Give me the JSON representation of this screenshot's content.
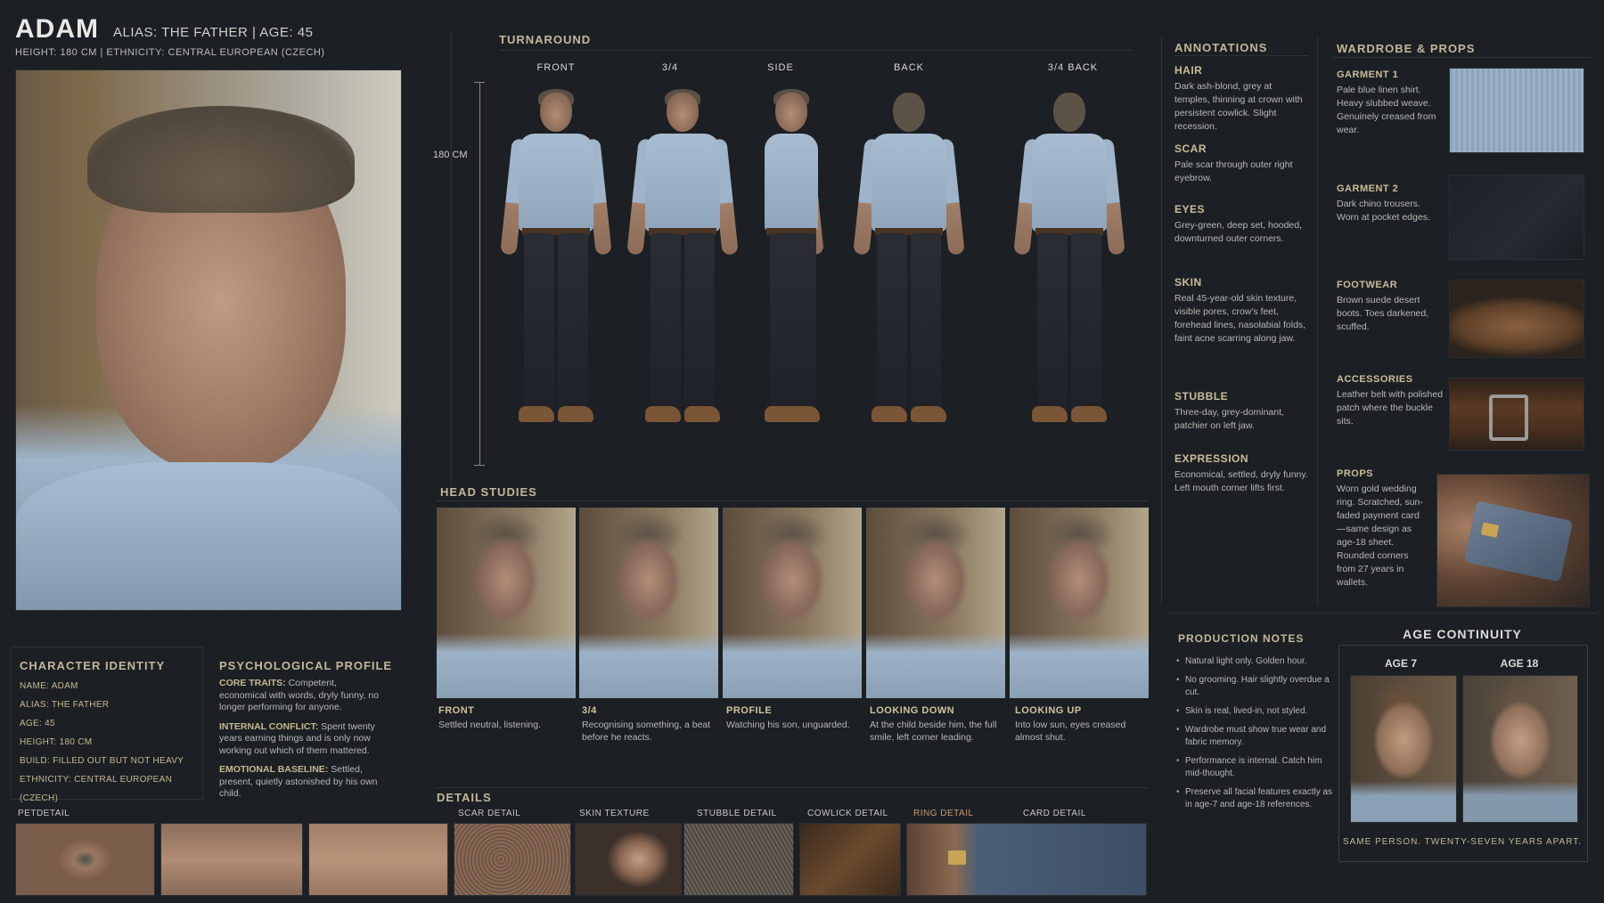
{
  "header": {
    "name": "ADAM",
    "alias": "ALIAS: THE FATHER  |  AGE: 45",
    "sub": "HEIGHT: 180 CM  |  ETHNICITY: CENTRAL EUROPEAN (CZECH)"
  },
  "turnaround": {
    "title": "TURNAROUND",
    "height_label": "180 CM",
    "views": [
      "FRONT",
      "3/4",
      "SIDE",
      "BACK",
      "3/4 BACK"
    ]
  },
  "annotations": {
    "title": "ANNOTATIONS",
    "items": [
      {
        "title": "HAIR",
        "text": "Dark ash-blond, grey at temples, thinning at crown with persistent cowlick. Slight recession."
      },
      {
        "title": "SCAR",
        "text": "Pale scar through outer right eyebrow."
      },
      {
        "title": "EYES",
        "text": "Grey-green, deep set, hooded, downturned outer corners."
      },
      {
        "title": "SKIN",
        "text": "Real 45-year-old skin texture, visible pores, crow's feet, forehead lines, nasolabial folds, faint acne scarring along jaw."
      },
      {
        "title": "STUBBLE",
        "text": "Three-day, grey-dominant, patchier on left jaw."
      },
      {
        "title": "EXPRESSION",
        "text": "Economical, settled, dryly funny. Left mouth corner lifts first."
      }
    ]
  },
  "wardrobe": {
    "title": "WARDROBE & PROPS",
    "items": [
      {
        "title": "GARMENT 1",
        "text": "Pale blue linen shirt. Heavy slubbed weave. Genuinely creased from wear."
      },
      {
        "title": "GARMENT 2",
        "text": "Dark chino trousers. Worn at pocket edges."
      },
      {
        "title": "FOOTWEAR",
        "text": "Brown suede desert boots. Toes darkened, scuffed."
      },
      {
        "title": "ACCESSORIES",
        "text": "Leather belt with polished patch where the buckle sits."
      },
      {
        "title": "PROPS",
        "text": "Worn gold wedding ring. Scratched, sun-faded payment card—same design as age-18 sheet. Rounded corners from 27 years in wallets."
      }
    ]
  },
  "head_studies": {
    "title": "HEAD STUDIES",
    "items": [
      {
        "title": "FRONT",
        "text": "Settled neutral, listening."
      },
      {
        "title": "3/4",
        "text": "Recognising something, a beat before he reacts."
      },
      {
        "title": "PROFILE",
        "text": "Watching his son, unguarded."
      },
      {
        "title": "LOOKING DOWN",
        "text": "At the child beside him, the full smile, left corner leading."
      },
      {
        "title": "LOOKING UP",
        "text": "Into low sun, eyes creased almost shut."
      }
    ]
  },
  "identity": {
    "title": "CHARACTER IDENTITY",
    "lines": [
      "NAME: ADAM",
      "ALIAS: THE FATHER",
      "AGE: 45",
      "HEIGHT: 180 CM",
      "BUILD: FILLED OUT BUT NOT HEAVY",
      "ETHNICITY: CENTRAL EUROPEAN (CZECH)"
    ]
  },
  "psych": {
    "title": "PSYCHOLOGICAL PROFILE",
    "items": [
      {
        "label": "CORE TRAITS:",
        "text": " Competent, economical with words, dryly funny, no longer performing for anyone."
      },
      {
        "label": "INTERNAL CONFLICT:",
        "text": " Spent twenty years earning things and is only now working out which of them mattered."
      },
      {
        "label": "EMOTIONAL BASELINE:",
        "text": " Settled, present, quietly astonished by his own child."
      }
    ]
  },
  "production": {
    "title": "PRODUCTION NOTES",
    "notes": [
      "Natural light only. Golden hour.",
      "No grooming. Hair slightly overdue a cut.",
      "Skin is real, lived-in, not styled.",
      "Wardrobe must show true wear and fabric memory.",
      "Performance is internal. Catch him mid-thought.",
      "Preserve all facial features exactly as in age-7 and age-18 references."
    ]
  },
  "age": {
    "title": "AGE CONTINUITY",
    "labels": [
      "AGE 7",
      "AGE 18"
    ],
    "caption": "SAME PERSON. TWENTY-SEVEN YEARS APART."
  },
  "details": {
    "title": "DETAILS",
    "labels": [
      "PETDETAIL",
      "SCAR DETAIL",
      "SKIN TEXTURE",
      "STUBBLE DETAIL",
      "COWLICK DETAIL",
      "RING DETAIL",
      "CARD DETAIL"
    ]
  }
}
